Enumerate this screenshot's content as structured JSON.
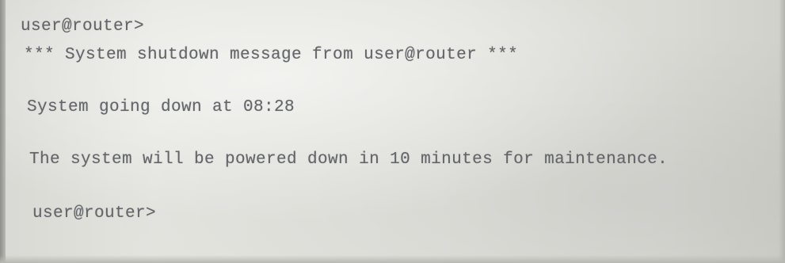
{
  "terminal": {
    "prompt_1": "user@router>",
    "shutdown_header": "*** System shutdown message from user@router ***",
    "going_down": "System going down at 08:28",
    "maintenance_message": "The system will be powered down in 10 minutes for maintenance.",
    "prompt_2": "user@router>"
  }
}
